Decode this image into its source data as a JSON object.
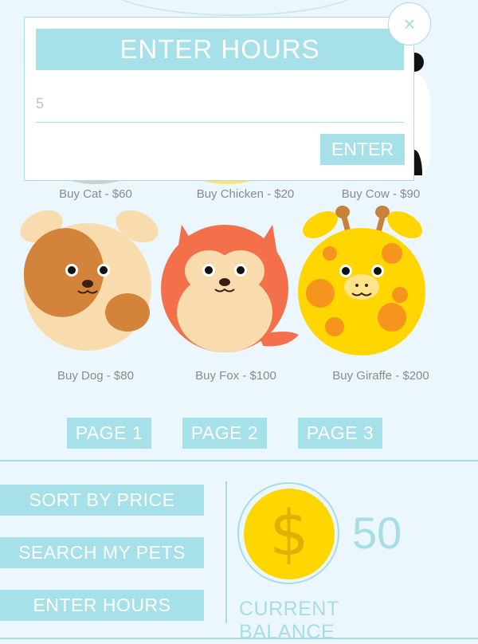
{
  "modal": {
    "title": "ENTER HOURS",
    "input_value": "5",
    "enter_label": "ENTER",
    "close_glyph": "×"
  },
  "pets_row1_labels": [
    {
      "label": "Buy Cat - $60"
    },
    {
      "label": "Buy Chicken - $20"
    },
    {
      "label": "Buy Cow - $90"
    }
  ],
  "pets_row2": [
    {
      "label": "Buy Dog - $80",
      "icon": "dog-icon"
    },
    {
      "label": "Buy Fox - $100",
      "icon": "fox-icon"
    },
    {
      "label": "Buy Giraffe - $200",
      "icon": "giraffe-icon"
    }
  ],
  "pagination": [
    "PAGE 1",
    "PAGE 2",
    "PAGE 3"
  ],
  "actions": {
    "sort": "SORT BY PRICE",
    "search": "SEARCH MY PETS",
    "enter_hours": "ENTER HOURS"
  },
  "balance": {
    "currency_symbol": "$",
    "amount": "50",
    "label": "CURRENT BALANCE"
  },
  "colors": {
    "background": "#ecf6fd",
    "accent": "#a6e0e8",
    "coin": "#ffd600"
  }
}
